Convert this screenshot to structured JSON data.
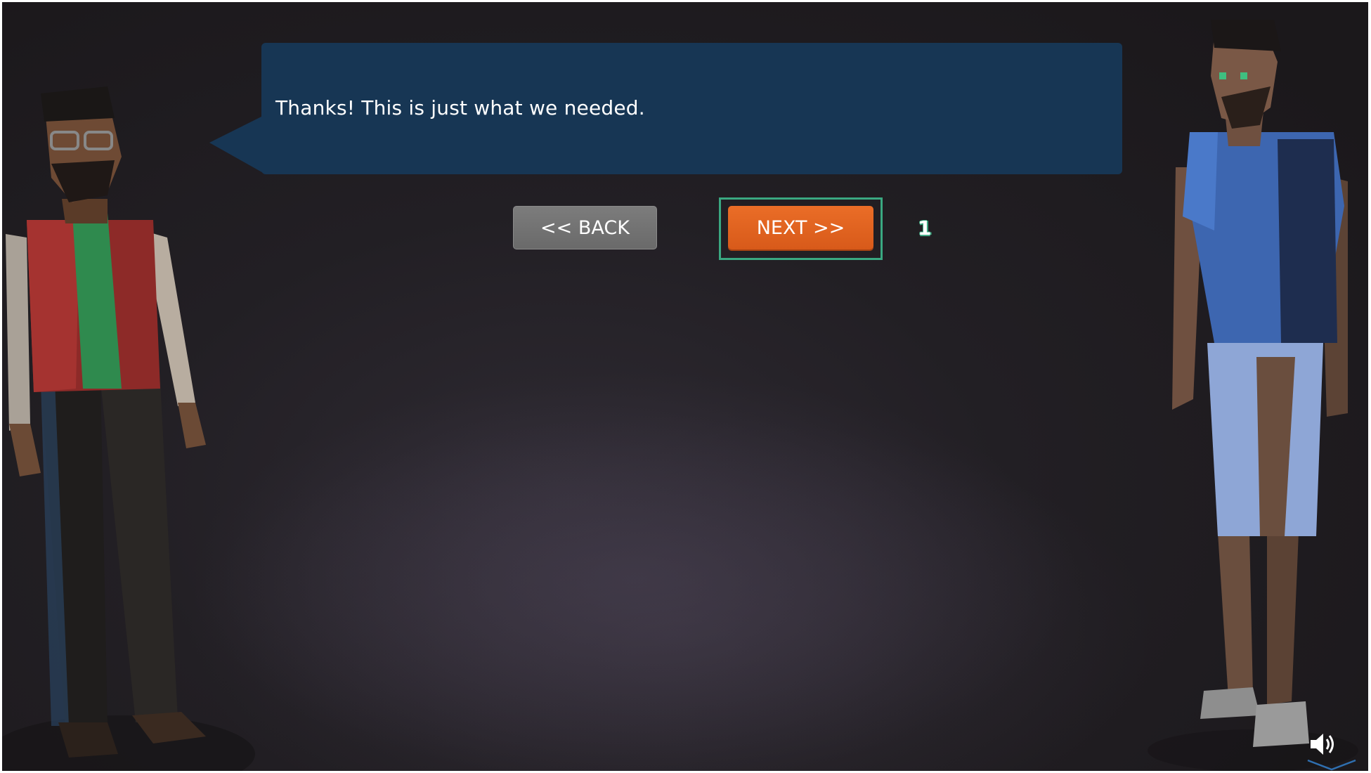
{
  "dialog": {
    "text": "Thanks! This is just what we needed."
  },
  "nav": {
    "back_label": "<< BACK",
    "next_label": "NEXT >>",
    "step_badge": "1"
  },
  "colors": {
    "bubble": "#173654",
    "next_button": "#e2641f",
    "back_button": "#737373",
    "focus_ring": "#3aa881"
  },
  "icons": {
    "audio": "speaker-icon",
    "expand": "chevron-down-icon"
  }
}
